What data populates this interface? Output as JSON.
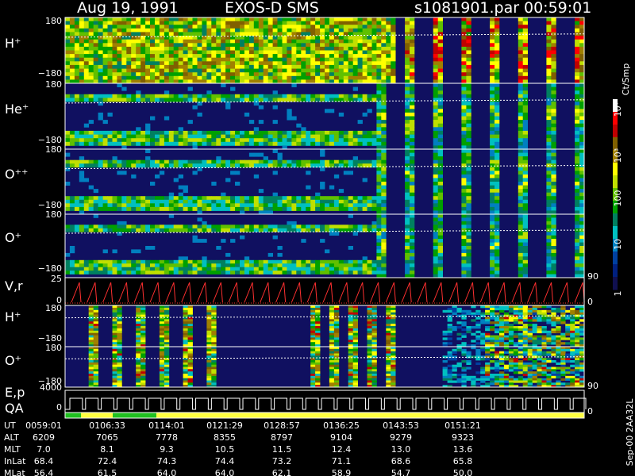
{
  "header": {
    "date": "Aug 19, 1991",
    "instrument": "EXOS-D SMS",
    "file": "s1081901.par",
    "time": "00:59:01"
  },
  "colorbar": {
    "label": "Ct/Smp",
    "ticks": [
      "10⁴",
      "10³",
      "100",
      "10",
      "1"
    ],
    "colors": [
      "#ffffff",
      "#ff0000",
      "#c00000",
      "#806000",
      "#a08000",
      "#ffff00",
      "#c0e000",
      "#60c000",
      "#00a000",
      "#008060",
      "#00c0c0",
      "#0080c0",
      "#0040a0",
      "#002080",
      "#101050"
    ]
  },
  "panels": [
    {
      "id": "hplus1",
      "label": "H⁺",
      "ytop": "180",
      "ybot": "−180"
    },
    {
      "id": "heplus",
      "label": "He⁺",
      "ytop": "180",
      "ybot": "−180"
    },
    {
      "id": "oplusplus",
      "label": "O⁺⁺",
      "ytop": "180",
      "ybot": "−180"
    },
    {
      "id": "oplus1",
      "label": "O⁺",
      "ytop": "180",
      "ybot": "−180",
      "right": "90"
    },
    {
      "id": "vr",
      "label": "V,r",
      "ytop": "25",
      "ybot": "0",
      "right": "0"
    },
    {
      "id": "hplus2",
      "label": "H⁺",
      "ytop": "180",
      "ybot": "−180"
    },
    {
      "id": "oplus2",
      "label": "O⁺",
      "ytop": "180",
      "ybot": "−180",
      "right": "90"
    },
    {
      "id": "ep",
      "label": "E,p",
      "ytop": "4000",
      "ybot": "0",
      "right": "0"
    },
    {
      "id": "qa",
      "label": "QA"
    }
  ],
  "side_stamp": "Sep-00 2AA32L",
  "chart_data": {
    "type": "heatmap",
    "x_label": "UT",
    "ut_ticks": [
      "0059:01",
      "0106:33",
      "0114:01",
      "0121:29",
      "0128:57",
      "0136:25",
      "0143:53",
      "0151:21"
    ],
    "table": [
      {
        "name": "UT",
        "values": [
          "0059:01",
          "0106:33",
          "0114:01",
          "0121:29",
          "0128:57",
          "0136:25",
          "0143:53",
          "0151:21"
        ]
      },
      {
        "name": "ALT",
        "values": [
          "6209",
          "7065",
          "7778",
          "8355",
          "8797",
          "9104",
          "9279",
          "9323"
        ]
      },
      {
        "name": "MLT",
        "values": [
          "7.0",
          "8.1",
          "9.3",
          "10.5",
          "11.5",
          "12.4",
          "13.0",
          "13.6"
        ]
      },
      {
        "name": "InLat",
        "values": [
          "68.4",
          "72.4",
          "74.3",
          "74.4",
          "73.2",
          "71.1",
          "68.6",
          "65.8"
        ]
      },
      {
        "name": "MLat",
        "values": [
          "56.4",
          "61.5",
          "64.0",
          "64.0",
          "62.1",
          "58.9",
          "54.7",
          "50.0"
        ]
      }
    ]
  }
}
